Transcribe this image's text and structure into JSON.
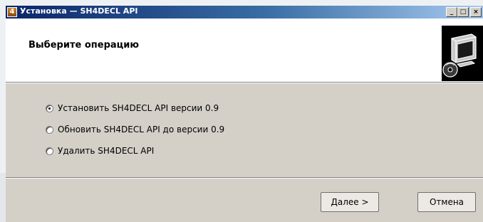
{
  "window": {
    "title": "Установка — SH4DECL API",
    "app_icon_glyph": "4",
    "controls": {
      "minimize": "_",
      "maximize": "□",
      "close": "×"
    }
  },
  "header": {
    "title": "Выберите операцию",
    "icon": "computer-install-icon"
  },
  "options": [
    {
      "label": "Установить SH4DECL API версии 0.9",
      "checked": true
    },
    {
      "label": "Обновить SH4DECL API до версии 0.9",
      "checked": false
    },
    {
      "label": "Удалить SH4DECL API",
      "checked": false
    }
  ],
  "buttons": {
    "next": "Далее >",
    "cancel": "Отмена"
  },
  "colors": {
    "titlebar_start": "#0a246a",
    "titlebar_end": "#a6caf0",
    "dialog_bg": "#d4d0c8"
  }
}
